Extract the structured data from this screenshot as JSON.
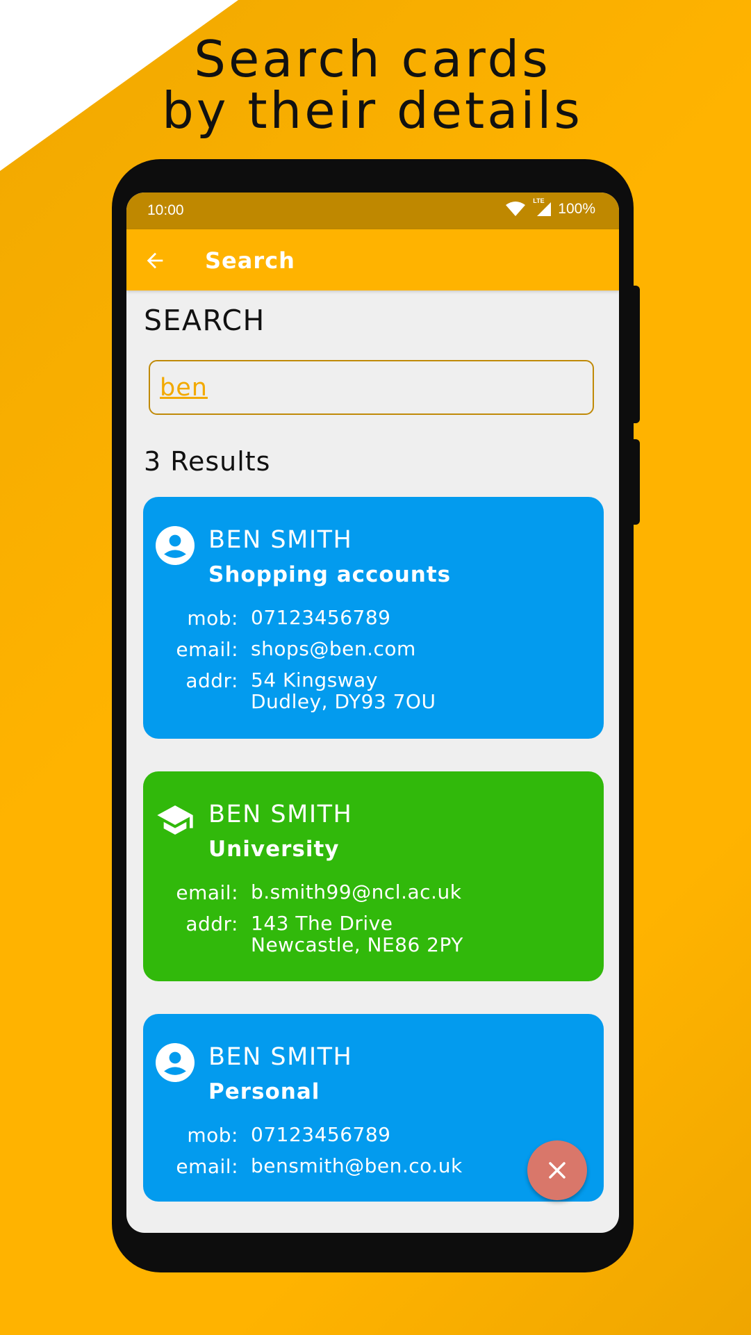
{
  "headline": {
    "line1": "Search cards",
    "line2": "by their details"
  },
  "status_bar": {
    "time": "10:00",
    "network": "LTE",
    "battery": "100%"
  },
  "app_bar": {
    "title": "Search",
    "back_icon": "arrow-back-icon"
  },
  "search": {
    "section_title": "SEARCH",
    "query": "ben"
  },
  "results": {
    "count_label": "3 Results",
    "cards": [
      {
        "color": "#039BEE",
        "icon": "account-circle-icon",
        "name": "BEN SMITH",
        "category": "Shopping accounts",
        "fields": [
          {
            "label": "mob:",
            "value": "07123456789"
          },
          {
            "label": "email:",
            "value": "shops@ben.com"
          },
          {
            "label": "addr:",
            "line1": "54 Kingsway",
            "line2": "Dudley, DY93 7OU"
          }
        ]
      },
      {
        "color": "#31B90B",
        "icon": "school-icon",
        "name": "BEN SMITH",
        "category": "University",
        "fields": [
          {
            "label": "email:",
            "value": "b.smith99@ncl.ac.uk"
          },
          {
            "label": "addr:",
            "line1": "143 The Drive",
            "line2": "Newcastle, NE86 2PY"
          }
        ]
      },
      {
        "color": "#039BEE",
        "icon": "account-circle-icon",
        "name": "BEN SMITH",
        "category": "Personal",
        "fields": [
          {
            "label": "mob:",
            "value": "07123456789"
          },
          {
            "label": "email:",
            "value": "bensmith@ben.co.uk"
          }
        ]
      }
    ]
  },
  "fab": {
    "icon": "close-icon",
    "color": "#D9776A"
  },
  "colors": {
    "accent": "#FFB300",
    "status_bar": "#BF8800",
    "background": "#EFEFEF"
  }
}
